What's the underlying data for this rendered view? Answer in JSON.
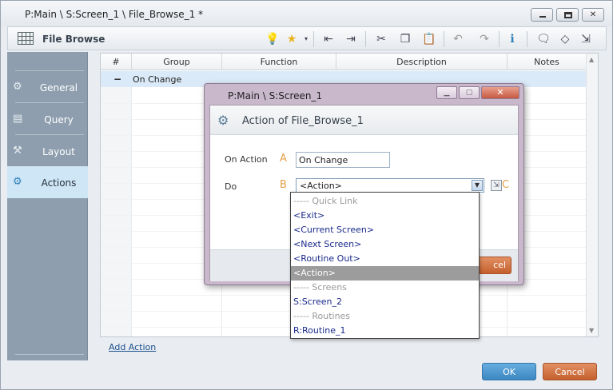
{
  "window": {
    "title": "P:Main \\ S:Screen_1 \\ File_Browse_1 *"
  },
  "toolbar": {
    "title": "File Browse"
  },
  "sidebar": {
    "items": [
      {
        "label": "General",
        "icon": "gear-icon"
      },
      {
        "label": "Query",
        "icon": "query-icon"
      },
      {
        "label": "Layout",
        "icon": "layout-icon"
      },
      {
        "label": "Actions",
        "icon": "actions-icon",
        "active": true
      }
    ]
  },
  "grid": {
    "columns": [
      "#",
      "Group",
      "Function",
      "Description",
      "Notes"
    ],
    "group_row": {
      "toggle": "−",
      "label": "On Change"
    }
  },
  "footer": {
    "add_action": "Add Action",
    "ok": "OK",
    "cancel": "Cancel"
  },
  "dialog": {
    "title": "P:Main \\ S:Screen_1",
    "heading": "Action of File_Browse_1",
    "on_action_label": "On Action",
    "do_label": "Do",
    "marker_a": "A",
    "marker_b": "B",
    "marker_c": "C",
    "on_action_value": "On Change",
    "do_value": "<Action>",
    "cancel_partial": "cel"
  },
  "dropdown": {
    "items": [
      {
        "label": "----- Quick Link",
        "header": true
      },
      {
        "label": "<Exit>"
      },
      {
        "label": "<Current Screen>"
      },
      {
        "label": "<Next Screen>"
      },
      {
        "label": "<Routine Out>"
      },
      {
        "label": "<Action>",
        "selected": true
      },
      {
        "label": "----- Screens",
        "header": true
      },
      {
        "label": "S:Screen_2"
      },
      {
        "label": "----- Routines",
        "header": true
      },
      {
        "label": "R:Routine_1"
      }
    ]
  }
}
